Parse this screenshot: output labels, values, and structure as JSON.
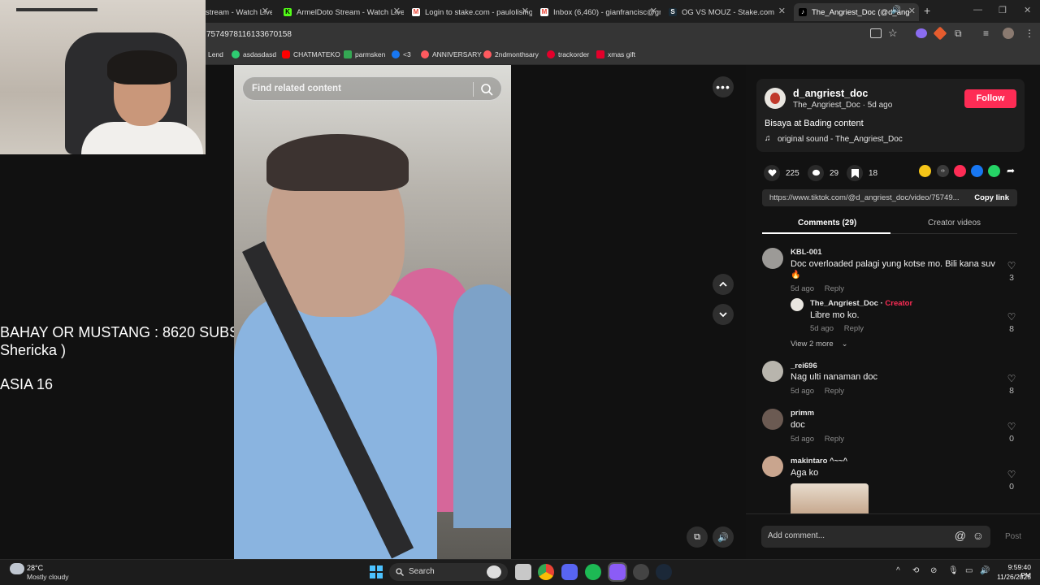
{
  "browser": {
    "tabs": [
      {
        "title": "stream - Watch Live",
        "favicon_color": "#53fc18"
      },
      {
        "title": "ArmelDoto Stream - Watch Live",
        "favicon_color": "#53fc18"
      },
      {
        "title": "Login to stake.com - paulolising",
        "favicon_color": "#ea4335"
      },
      {
        "title": "Inbox (6,460) - gianfrancisc@gr",
        "favicon_color": "#ea4335"
      },
      {
        "title": "OG VS MOUZ - Stake.com",
        "favicon_color": "#ffffff"
      },
      {
        "title": "The_Angriest_Doc (@d_ang",
        "favicon_color": "#ffffff"
      }
    ],
    "url": "7574978116133670158",
    "bookmarks": [
      {
        "label": "Lend",
        "color": "#888888"
      },
      {
        "label": "asdasdasd",
        "color": "#2ecc71"
      },
      {
        "label": "CHATMATEKO",
        "color": "#ff0000"
      },
      {
        "label": "parmsken",
        "color": "#34a853"
      },
      {
        "label": "<3",
        "color": "#1877f2"
      },
      {
        "label": "ANNIVERSARY",
        "color": "#ff5a5f"
      },
      {
        "label": "2ndmonthsary",
        "color": "#ff5a5f"
      },
      {
        "label": "trackorder",
        "color": "#e4002b"
      },
      {
        "label": "xmas gift",
        "color": "#e4002b"
      }
    ]
  },
  "stream_overlay": {
    "line1": "BAHAY OR MUSTANG : 8620 SUBS",
    "line2": "Shericka )",
    "line3": "ASIA 16"
  },
  "video": {
    "search_placeholder": "Find related content"
  },
  "post": {
    "username": "d_angriest_doc",
    "display_meta": "The_Angriest_Doc · 5d ago",
    "follow_label": "Follow",
    "caption": "Bisaya at Bading content",
    "sound": "original sound - The_Angriest_Doc",
    "likes": "225",
    "comments_count": "29",
    "saves": "18",
    "link": "https://www.tiktok.com/@d_angriest_doc/video/75749...",
    "copy_link_label": "Copy link",
    "tab_comments": "Comments (29)",
    "tab_creator": "Creator videos"
  },
  "comments": [
    {
      "user": "KBL-001",
      "text": "Doc overloaded palagi yung kotse mo. Bili kana suv",
      "text2": "🔥",
      "age": "5d ago",
      "reply": "Reply",
      "likes": "3"
    },
    {
      "user": "The_Angriest_Doc",
      "badge": "Creator",
      "text": "Libre mo ko.",
      "age": "5d ago",
      "reply": "Reply",
      "likes": "8"
    },
    {
      "view_more": "View 2 more"
    },
    {
      "user": "_rei696",
      "text": "Nag ulti nanaman doc",
      "age": "5d ago",
      "reply": "Reply",
      "likes": "8"
    },
    {
      "user": "primm",
      "text": "doc",
      "age": "5d ago",
      "reply": "Reply",
      "likes": "0"
    },
    {
      "user": "makintaro ^~~^",
      "text": "Aga ko",
      "likes": "0"
    }
  ],
  "comment_box": {
    "placeholder": "Add comment...",
    "post_label": "Post"
  },
  "taskbar": {
    "weather_temp": "28°C",
    "weather_desc": "Mostly cloudy",
    "search_label": "Search",
    "time": "9:59:40 PM",
    "date": "11/26/2025"
  }
}
